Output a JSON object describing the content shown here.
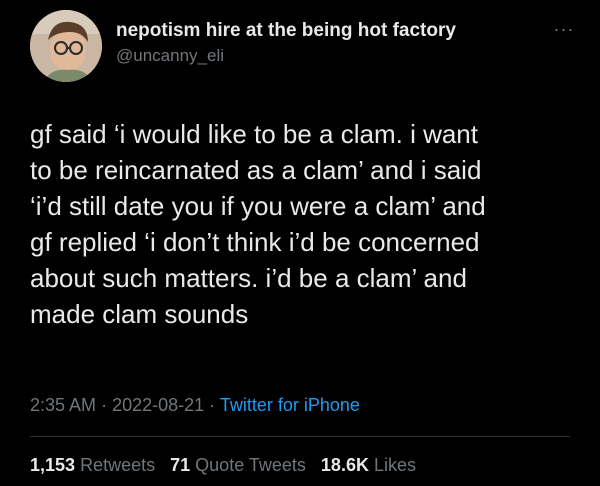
{
  "tweet": {
    "display_name": "nepotism hire at the being hot factory",
    "handle": "@uncanny_eli",
    "more_icon": "more-horizontal-icon",
    "text": "gf said ‘i would like to be a clam. i want\nto be reincarnated as a clam’ and i said\n‘i’d still date you if you were a clam’ and\ngf replied ‘i don’t think i’d be concerned\nabout such matters. i’d be a clam’ and\nmade clam sounds",
    "time": "2:35 AM",
    "separator": "·",
    "date": "2022-08-21",
    "source": "Twitter for iPhone"
  },
  "stats": {
    "retweets_count": "1,153",
    "retweets_label": "Retweets",
    "quotes_count": "71",
    "quotes_label": "Quote Tweets",
    "likes_count": "18.6K",
    "likes_label": "Likes"
  },
  "colors": {
    "background": "#000000",
    "primary_text": "#e7e9ea",
    "secondary_text": "#71767b",
    "link": "#1d9bf0",
    "divider": "#2f3336"
  }
}
